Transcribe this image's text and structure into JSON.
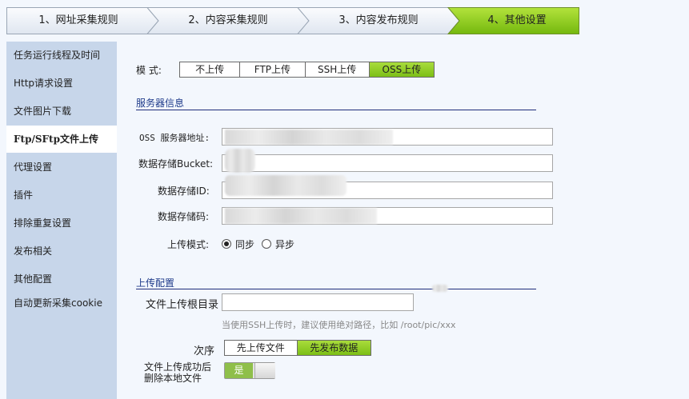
{
  "steps": [
    "1、网址采集规则",
    "2、内容采集规则",
    "3、内容发布规则",
    "4、其他设置"
  ],
  "sidebar": [
    "任务运行线程及时间",
    "Http请求设置",
    "文件图片下载",
    "Ftp/SFtp文件上传",
    "代理设置",
    "插件",
    "排除重复设置",
    "发布相关",
    "其他配置",
    "自动更新采集cookie"
  ],
  "mode": {
    "label": "模  式:",
    "options": [
      "不上传",
      "FTP上传",
      "SSH上传",
      "OSS上传"
    ],
    "selected": "OSS上传"
  },
  "server": {
    "title": "服务器信息",
    "oss_address_label": "OSS 服务器地址:",
    "bucket_label": "数据存储Bucket:",
    "id_label": "数据存储ID:",
    "code_label": "数据存储码:",
    "upload_mode_label": "上传模式:",
    "sync_label": "同步",
    "async_label": "异步"
  },
  "upload": {
    "title": "上传配置",
    "root_dir_label": "文件上传根目录",
    "root_dir_value": "",
    "hint": "当使用SSH上传时，建议使用绝对路径，比如  /root/pic/xxx",
    "order_label": "次序",
    "order_options": [
      "先上传文件",
      "先发布数据"
    ],
    "order_selected": "先发布数据",
    "delete_label_line1": "文件上传成功后",
    "delete_label_line2": "删除本地文件",
    "delete_toggle_text": "是"
  },
  "colors": {
    "accent_green": "#7cbf16",
    "sidebar_bg": "#c7d6ea",
    "title_blue": "#1e3a8a"
  }
}
